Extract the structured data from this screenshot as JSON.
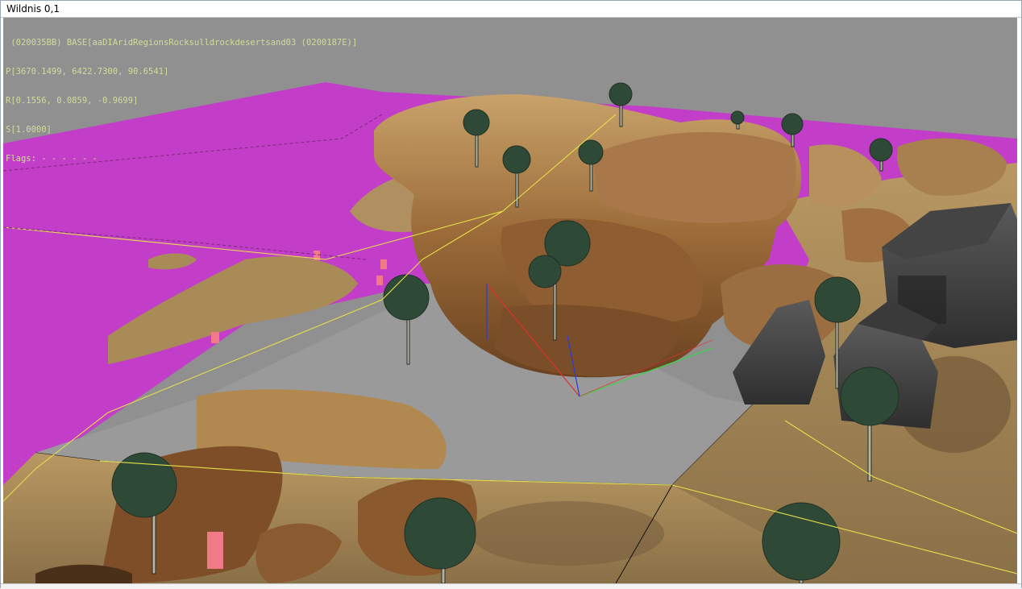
{
  "window": {
    "title": "Wildnis 0,1"
  },
  "viewport": {
    "selection_info": {
      "line1": " (020035BB) BASE[aaDIAridRegionsRocksulldrockdesertsand03 (0200187E)]",
      "line2": "P[3670.1499, 6422.7300, 90.6541]",
      "line3": "R[0.1556, 0.0859, -0.9699]",
      "line4": "S[1.0000]",
      "line5": "Flags: - - - - - -"
    },
    "colors": {
      "background": "#909090",
      "missing_texture": "#c23ec8",
      "sand": "#b0905a",
      "rock": "#8a5a2e",
      "tree": "#2e4a36",
      "overlay_text": "#d2dc9a"
    }
  }
}
